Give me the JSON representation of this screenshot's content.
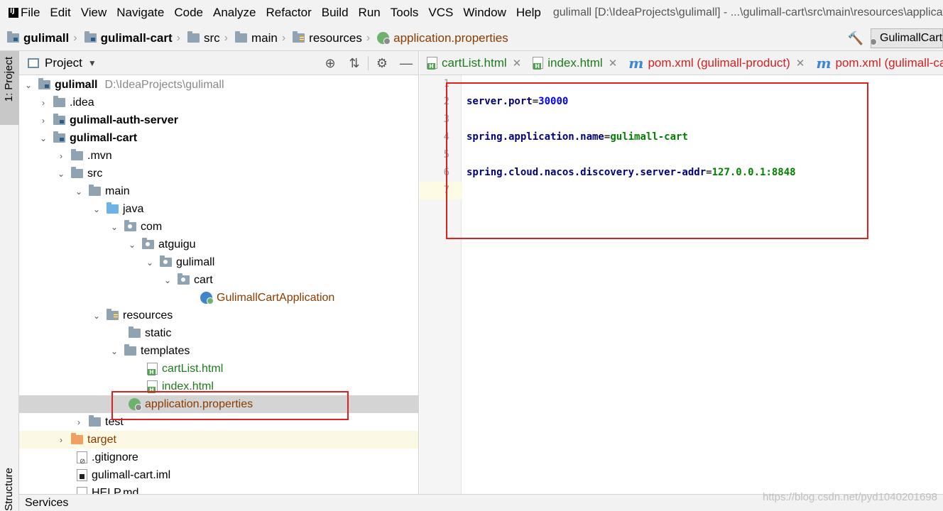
{
  "menubar": {
    "items": [
      "File",
      "Edit",
      "View",
      "Navigate",
      "Code",
      "Analyze",
      "Refactor",
      "Build",
      "Run",
      "Tools",
      "VCS",
      "Window",
      "Help"
    ],
    "window_title": "gulimall [D:\\IdeaProjects\\gulimall] - ...\\gulimall-cart\\src\\main\\resources\\application.properties"
  },
  "breadcrumb": [
    "gulimall",
    "gulimall-cart",
    "src",
    "main",
    "resources",
    "application.properties"
  ],
  "run_config": "GulimallCartApplication",
  "project_panel": {
    "title": "Project",
    "tree": [
      {
        "label": "gulimall",
        "extra": "D:\\IdeaProjects\\gulimall"
      },
      {
        "label": ".idea"
      },
      {
        "label": "gulimall-auth-server"
      },
      {
        "label": "gulimall-cart"
      },
      {
        "label": ".mvn"
      },
      {
        "label": "src"
      },
      {
        "label": "main"
      },
      {
        "label": "java"
      },
      {
        "label": "com"
      },
      {
        "label": "atguigu"
      },
      {
        "label": "gulimall"
      },
      {
        "label": "cart"
      },
      {
        "label": "GulimallCartApplication"
      },
      {
        "label": "resources"
      },
      {
        "label": "static"
      },
      {
        "label": "templates"
      },
      {
        "label": "cartList.html"
      },
      {
        "label": "index.html"
      },
      {
        "label": "application.properties"
      },
      {
        "label": "test"
      },
      {
        "label": "target"
      },
      {
        "label": ".gitignore"
      },
      {
        "label": "gulimall-cart.iml"
      },
      {
        "label": "HELP.md"
      }
    ]
  },
  "tabs": [
    {
      "label": "cartList.html"
    },
    {
      "label": "index.html"
    },
    {
      "label": "pom.xml (gulimall-product)"
    },
    {
      "label": "pom.xml (gulimall-cart)"
    }
  ],
  "editor": {
    "line_numbers": [
      "1",
      "2",
      "3",
      "4",
      "5",
      "6",
      "7"
    ],
    "lines": [
      {
        "key": "",
        "value": ""
      },
      {
        "key": "server.port",
        "value": "30000"
      },
      {
        "key": "",
        "value": ""
      },
      {
        "key": "spring.application.name",
        "value": "gulimall-cart"
      },
      {
        "key": "",
        "value": ""
      },
      {
        "key": "spring.cloud.nacos.discovery.server-addr",
        "value": "127.0.0.1:8848"
      },
      {
        "key": "",
        "value": ""
      }
    ]
  },
  "toolstrip": {
    "project": "1: Project",
    "structure": "Structure"
  },
  "bottom": {
    "services": "Services"
  },
  "watermark": "https://blog.csdn.net/pyd1040201698"
}
